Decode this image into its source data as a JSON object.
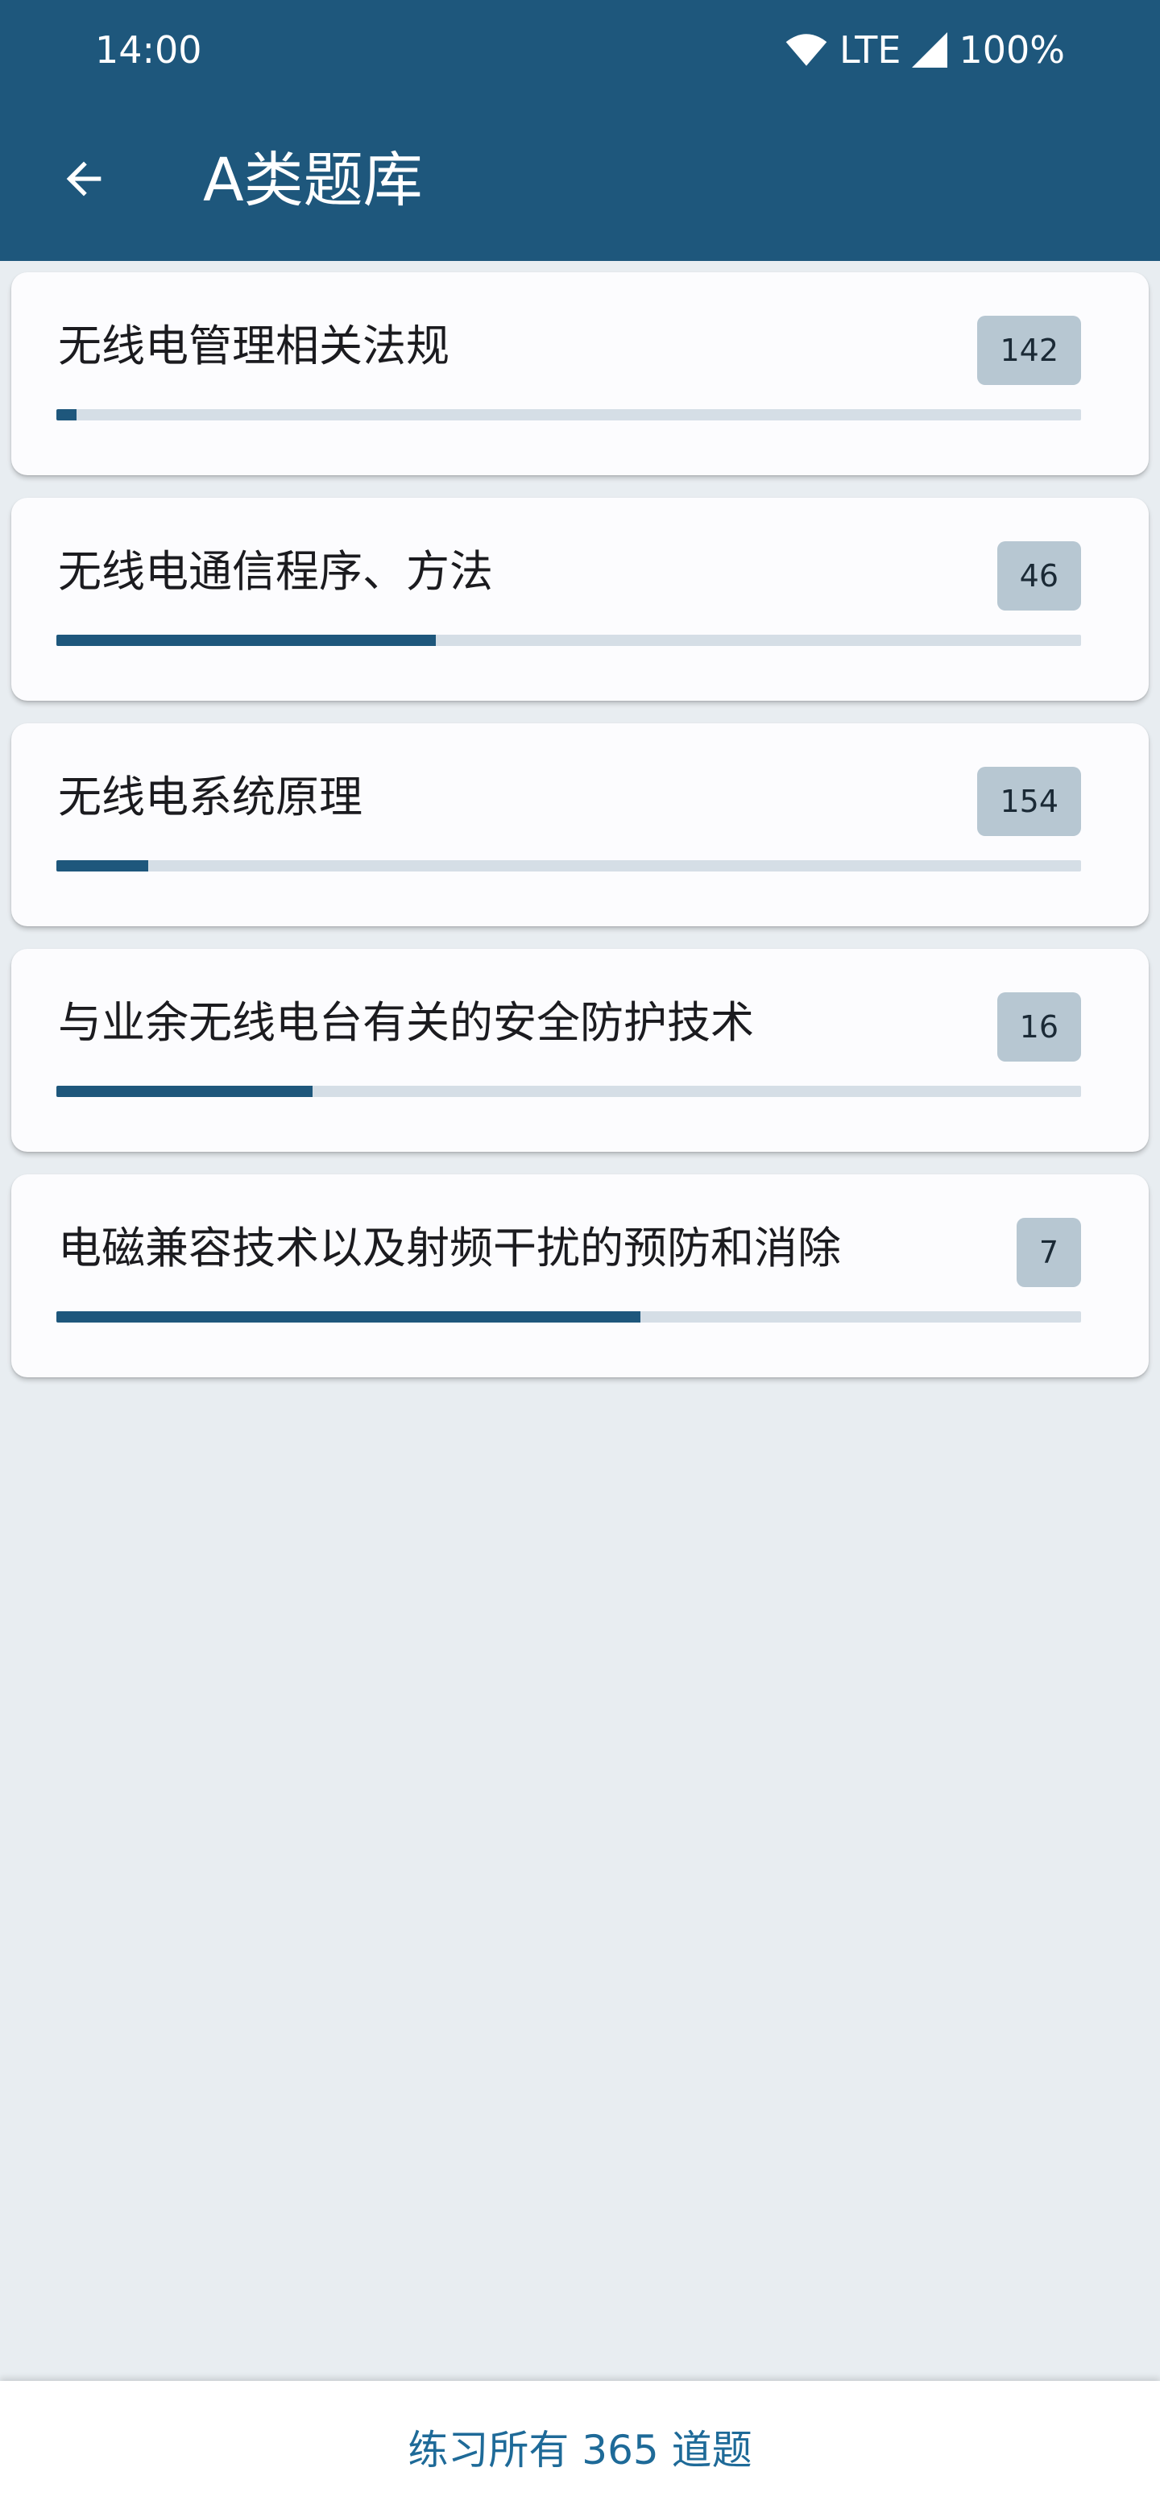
{
  "status_bar": {
    "time": "14:00",
    "network": "LTE",
    "battery": "100%",
    "icons": [
      "wifi-icon",
      "signal-icon"
    ]
  },
  "toolbar": {
    "back_icon": "arrow-back-icon",
    "title": "A类题库"
  },
  "categories": [
    {
      "title": "无线电管理相关法规",
      "count": "142",
      "progress": 0.02
    },
    {
      "title": "无线电通信程序、方法",
      "count": "46",
      "progress": 0.37
    },
    {
      "title": "无线电系统原理",
      "count": "154",
      "progress": 0.09
    },
    {
      "title": "与业余无线电台有关的安全防护技术",
      "count": "16",
      "progress": 0.25
    },
    {
      "title": "电磁兼容技术以及射频干扰的预防和消除",
      "count": "7",
      "progress": 0.57
    }
  ],
  "bottom": {
    "practice_all_label": "练习所有 365 道题"
  },
  "colors": {
    "primary": "#1e577c",
    "background": "#e8edf1",
    "card": "#fcfcfe",
    "badge": "#b7c7d2",
    "track": "#d5dee6",
    "button_text": "#1e6a98"
  }
}
